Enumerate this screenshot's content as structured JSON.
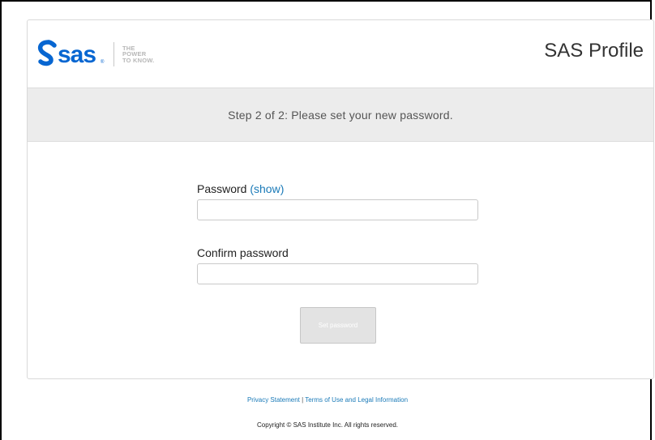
{
  "header": {
    "logo_text": "sas",
    "logo_tagline": "THE\nPOWER\nTO KNOW.",
    "app_title": "SAS Profile"
  },
  "step": {
    "text": "Step 2 of 2: Please set your new password."
  },
  "form": {
    "password_label": "Password",
    "show_link": "(show)",
    "password_value": "",
    "confirm_label": "Confirm password",
    "confirm_value": "",
    "submit_label": "Set password"
  },
  "footer": {
    "privacy_link": "Privacy Statement",
    "separator": "|",
    "terms_link": "Terms of Use and Legal Information",
    "copyright": "Copyright © SAS Institute Inc. All rights reserved."
  },
  "colors": {
    "brand_blue": "#0766d1",
    "link": "#1a7ab8",
    "step_bar_bg": "#ececec"
  }
}
